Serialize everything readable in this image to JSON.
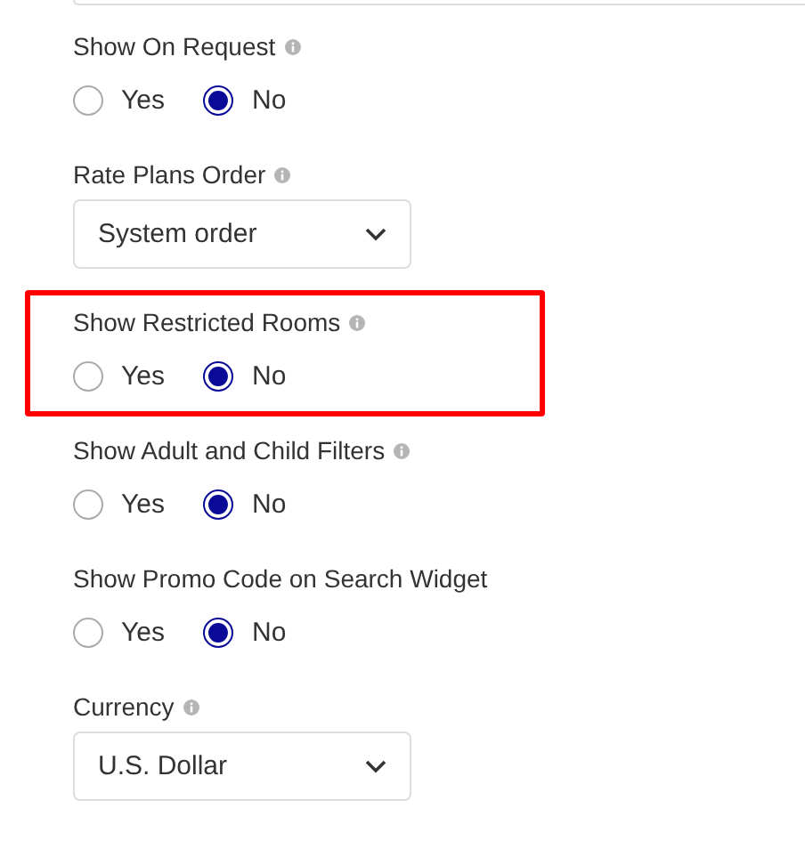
{
  "fields": [
    {
      "kind": "radio",
      "label": "Show On Request",
      "info": true,
      "highlighted": false,
      "options": [
        {
          "label": "Yes",
          "selected": false
        },
        {
          "label": "No",
          "selected": true
        }
      ]
    },
    {
      "kind": "select",
      "label": "Rate Plans Order",
      "info": true,
      "highlighted": false,
      "value": "System order"
    },
    {
      "kind": "radio",
      "label": "Show Restricted Rooms",
      "info": true,
      "highlighted": true,
      "options": [
        {
          "label": "Yes",
          "selected": false
        },
        {
          "label": "No",
          "selected": true
        }
      ]
    },
    {
      "kind": "radio",
      "label": "Show Adult and Child Filters",
      "info": true,
      "highlighted": false,
      "options": [
        {
          "label": "Yes",
          "selected": false
        },
        {
          "label": "No",
          "selected": true
        }
      ]
    },
    {
      "kind": "radio",
      "label": "Show Promo Code on Search Widget",
      "info": false,
      "highlighted": false,
      "options": [
        {
          "label": "Yes",
          "selected": false
        },
        {
          "label": "No",
          "selected": true
        }
      ]
    },
    {
      "kind": "select",
      "label": "Currency",
      "info": true,
      "highlighted": false,
      "value": "U.S. Dollar"
    }
  ]
}
